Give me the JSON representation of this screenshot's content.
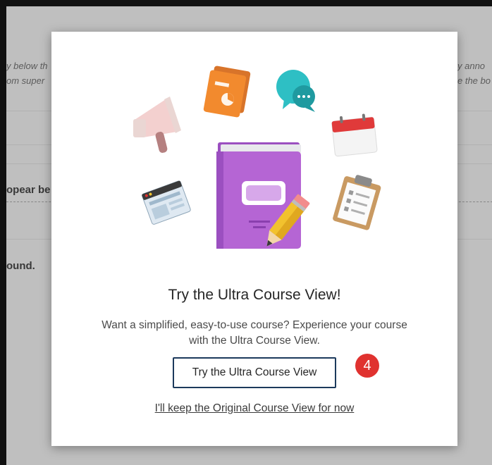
{
  "background": {
    "left_fragments": [
      "y below th",
      "om super",
      "opear be",
      "ound."
    ],
    "right_fragments": [
      "y anno",
      "e the bo"
    ]
  },
  "modal": {
    "title": "Try the Ultra Course View!",
    "description": "Want a simplified, easy-to-use course? Experience your course with the Ultra Course View.",
    "primary_button": "Try the Ultra Course View",
    "step_badge": "4",
    "secondary_link": "I'll keep the Original Course View for now",
    "illustration_icons": [
      "book-icon",
      "pencil-icon",
      "megaphone-icon",
      "document-icon",
      "chat-bubbles-icon",
      "calendar-icon",
      "browser-window-icon",
      "clipboard-icon"
    ]
  },
  "colors": {
    "button_border": "#1c3a5c",
    "badge": "#e0322f",
    "book": "#b565d4",
    "document": "#f28a2e",
    "chat": "#2ebfc4",
    "calendar": "#e03a3a"
  }
}
